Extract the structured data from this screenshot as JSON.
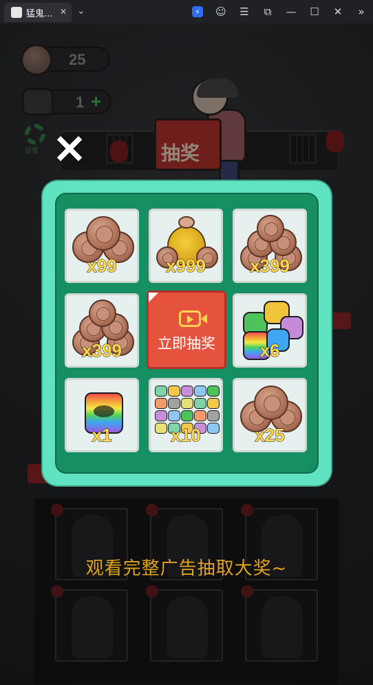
{
  "browser": {
    "tab_title": "猛鬼...",
    "tab_close": "✕",
    "dropdown": "⌄",
    "icons": [
      "bolt-icon",
      "profile-icon",
      "menu-icon",
      "crop-icon",
      "minimize-icon",
      "maximize-icon",
      "close-icon",
      "sidebar-icon"
    ],
    "glyphs": {
      "bolt": "⚡",
      "profile": "☺",
      "menu": "☰",
      "crop": "⧉",
      "minimize": "—",
      "maximize": "☐",
      "close": "✕",
      "sidebar": "»"
    }
  },
  "hud": {
    "coins": "25",
    "packs": "1",
    "plus": "+",
    "settings_label": "设置"
  },
  "scene": {
    "lottery_title": "抽奖",
    "close_symbol": "✕",
    "watch_hint": "观看完整广告抽取大奖~"
  },
  "prizes": [
    {
      "kind": "coins",
      "qty": "x99"
    },
    {
      "kind": "coin-sack",
      "qty": "x999"
    },
    {
      "kind": "coin-pile",
      "qty": "x399"
    },
    {
      "kind": "coin-pile",
      "qty": "x399"
    },
    {
      "kind": "spin-button",
      "label": "立即抽奖"
    },
    {
      "kind": "pack-group",
      "qty": "x6"
    },
    {
      "kind": "rainbow-pack",
      "qty": "x1"
    },
    {
      "kind": "pack-grid",
      "qty": "x10"
    },
    {
      "kind": "coins",
      "qty": "x25"
    }
  ],
  "colors": {
    "panel_border": "#5fe3c0",
    "panel_fill": "#168f63",
    "spin_button": "#e5533f",
    "qty_text": "#ffd74d",
    "hint_text": "#e0a31e"
  }
}
